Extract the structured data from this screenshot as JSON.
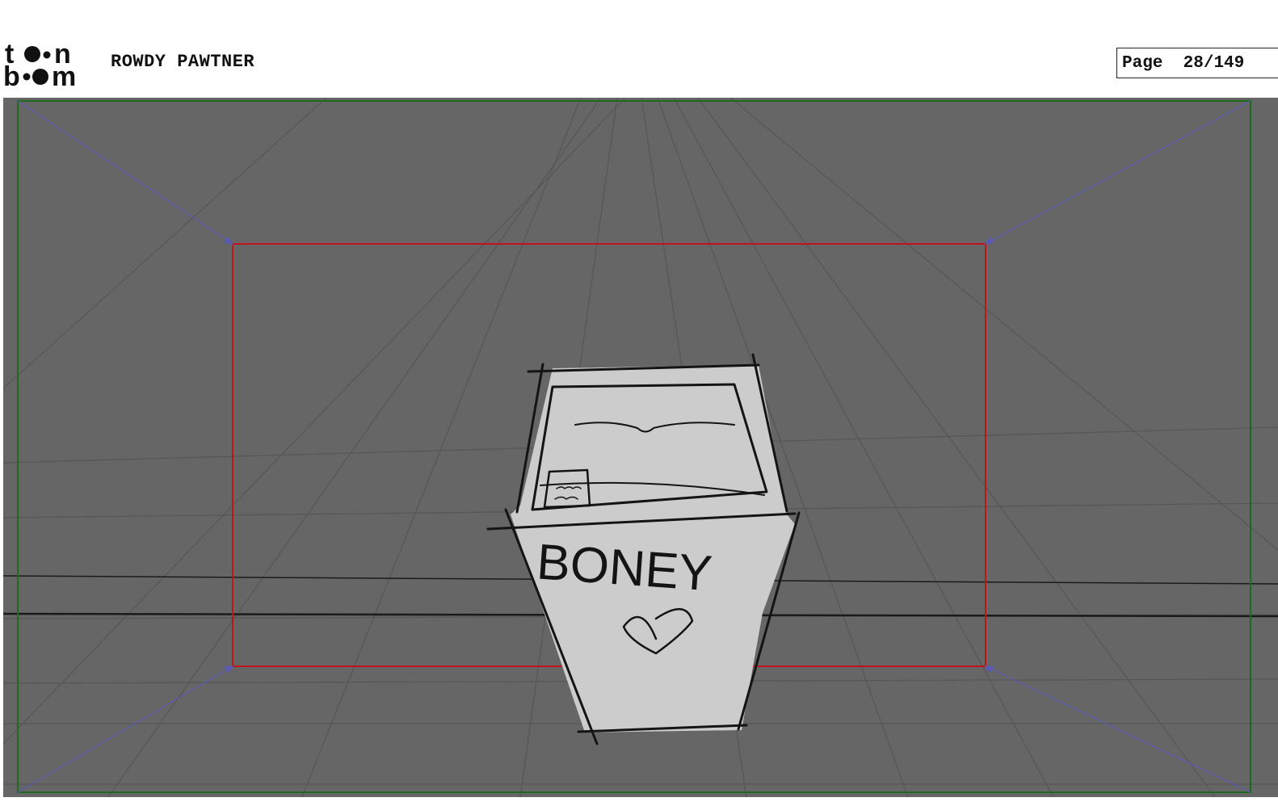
{
  "header": {
    "logo_text_top": "to n",
    "logo_text_bottom": "b m",
    "project_title": "ROWDY PAWTNER",
    "page_label": "Page",
    "page_number": "28/149"
  },
  "panel": {
    "sketch_text": "BONEY",
    "background_color": "#666666",
    "safe_frame_color": "#c0141a",
    "outer_frame_color": "#1e6a1e",
    "camera_move_color": "#5a5ab4"
  }
}
